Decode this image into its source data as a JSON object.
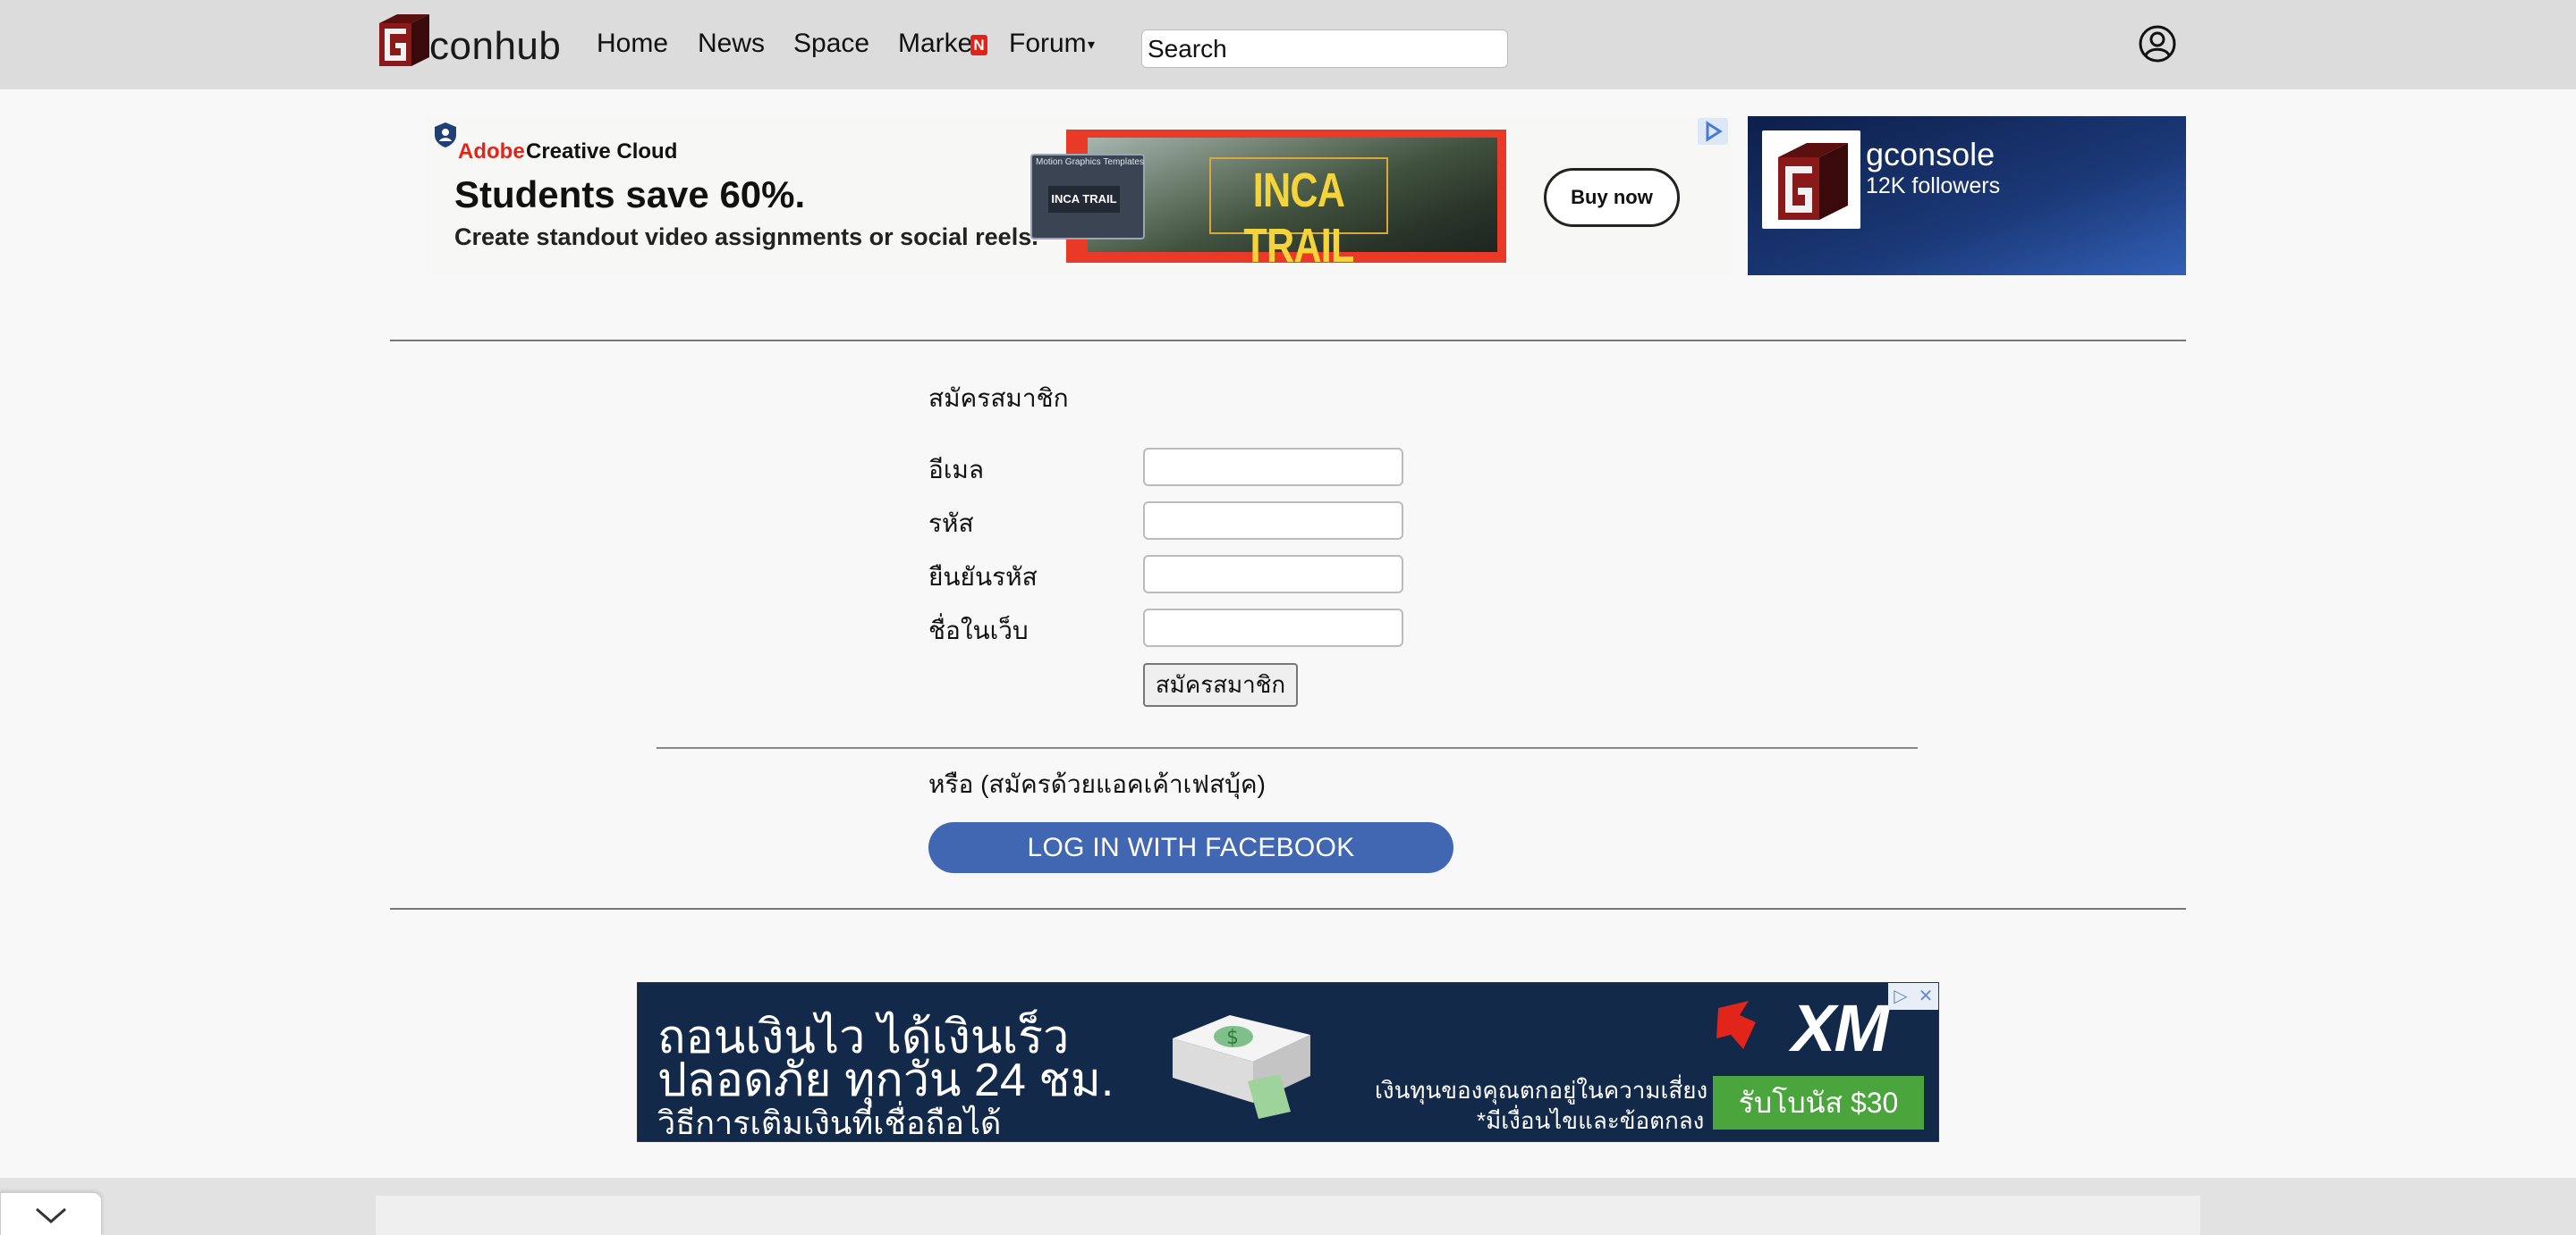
{
  "navbar": {
    "logo_text": "conhub",
    "items": [
      {
        "label": "Home"
      },
      {
        "label": "News"
      },
      {
        "label": "Space"
      },
      {
        "label": "Marke"
      },
      {
        "label": "Forum"
      }
    ],
    "new_badge": "N",
    "forum_caret": "▾",
    "search_placeholder": "Search",
    "icons": {
      "user": "user-circle-icon",
      "logo": "gamer-cube-logo"
    }
  },
  "ad_top": {
    "brand_accent": "Adobe",
    "brand_name": "Creative Cloud",
    "headline": "Students save 60%.",
    "subline": "Create standout video assignments or social reels.",
    "thumb_caption": "Motion Graphics Templates",
    "thumb_title": "INCA TRAIL",
    "image_title": "INCA TRAIL",
    "cta": "Buy now",
    "colors": {
      "brand_red": "#e1251b",
      "frame": "#e93a28",
      "title_yellow": "#f4d43a"
    }
  },
  "ad_page_card": {
    "name": "gconsole",
    "followers": "12K followers"
  },
  "signup": {
    "title": "สมัครสมาชิก",
    "fields": [
      {
        "label": "อีเมล",
        "value": ""
      },
      {
        "label": "รหัส",
        "value": ""
      },
      {
        "label": "ยืนยันรหัส",
        "value": ""
      },
      {
        "label": "ชื่อในเว็บ",
        "value": ""
      }
    ],
    "submit_label": "สมัครสมาชิก",
    "or_text": "หรือ (สมัครด้วยแอคเค้าเฟสบุ้ค)",
    "facebook_button": "LOG IN WITH FACEBOOK",
    "colors": {
      "facebook": "#4267b2"
    }
  },
  "ad_bottom": {
    "line1": "ถอนเงินไว ได้เงินเร็ว",
    "line2": "ปลอดภัย ทุกวัน 24 ชม.",
    "line3": "วิธีการเติมเงินที่เชื่อถือได้",
    "brand": "XM",
    "disclaimer1": "เงินทุนของคุณตกอยู่ในความเสี่ยง",
    "disclaimer2": "*มีเงื่อนไขและข้อตกลง",
    "bonus": "รับโบนัส $30",
    "colors": {
      "background": "#12294a",
      "bonus_green": "#4aa63c",
      "brand_red": "#e1251b"
    }
  },
  "footer": {
    "collapse_icon": "chevron-down-icon"
  }
}
